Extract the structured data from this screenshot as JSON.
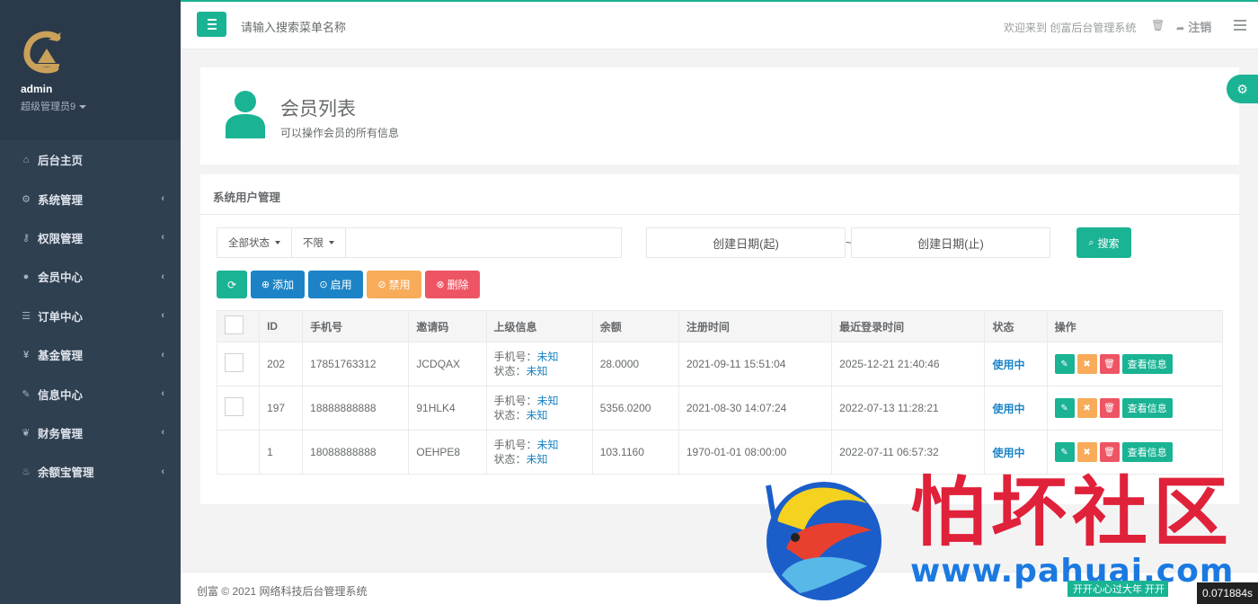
{
  "sidebar": {
    "user_name": "admin",
    "user_role": "超级管理员9",
    "items": [
      {
        "icon": "home-icon",
        "glyph": "⌂",
        "label": "后台主页",
        "has_arrow": false
      },
      {
        "icon": "cogs-icon",
        "glyph": "⚙",
        "label": "系统管理",
        "has_arrow": true
      },
      {
        "icon": "key-icon",
        "glyph": "⚷",
        "label": "权限管理",
        "has_arrow": true
      },
      {
        "icon": "user-icon",
        "glyph": "●",
        "label": "会员中心",
        "has_arrow": true
      },
      {
        "icon": "list-icon",
        "glyph": "☰",
        "label": "订单中心",
        "has_arrow": true
      },
      {
        "icon": "yen-icon",
        "glyph": "¥",
        "label": "基金管理",
        "has_arrow": true
      },
      {
        "icon": "wrench-icon",
        "glyph": "✎",
        "label": "信息中心",
        "has_arrow": true
      },
      {
        "icon": "leaf-icon",
        "glyph": "❦",
        "label": "财务管理",
        "has_arrow": true
      },
      {
        "icon": "fire-icon",
        "glyph": "♨",
        "label": "余额宝管理",
        "has_arrow": true
      }
    ]
  },
  "topbar": {
    "search_menu": "请输入搜索菜单名称",
    "welcome": "欢迎来到 创富后台管理系统",
    "logout": "注销"
  },
  "header": {
    "title": "会员列表",
    "subtitle": "可以操作会员的所有信息"
  },
  "panel": {
    "title": "系统用户管理",
    "filter_status": "全部状态",
    "filter_limit": "不限",
    "date_start": "创建日期(起)",
    "date_sep": "~",
    "date_end": "创建日期(止)",
    "search_label": "搜索"
  },
  "toolbar": {
    "add": "添加",
    "enable": "启用",
    "disable": "禁用",
    "delete": "删除"
  },
  "table": {
    "headers": [
      "",
      "ID",
      "手机号",
      "邀请码",
      "上级信息",
      "余额",
      "注册时间",
      "最近登录时间",
      "状态",
      "操作"
    ],
    "sup_phone_label": "手机号：",
    "sup_status_label": "状态：",
    "view_label": "查看信息",
    "rows": [
      {
        "checkbox": true,
        "id": "202",
        "phone": "17851763312",
        "invite": "JCDQAX",
        "sup_phone": "未知",
        "sup_status": "未知",
        "balance": "28.0000",
        "reg_time": "2021-09-11 15:51:04",
        "last_login": "2025-12-21 21:40:46",
        "status": "使用中"
      },
      {
        "checkbox": true,
        "id": "197",
        "phone": "18888888888",
        "invite": "91HLK4",
        "sup_phone": "未知",
        "sup_status": "未知",
        "balance": "5356.0200",
        "reg_time": "2021-08-30 14:07:24",
        "last_login": "2022-07-13 11:28:21",
        "status": "使用中"
      },
      {
        "checkbox": false,
        "id": "1",
        "phone": "18088888888",
        "invite": "OEHPE8",
        "sup_phone": "未知",
        "sup_status": "未知",
        "balance": "103.1160",
        "reg_time": "1970-01-01 08:00:00",
        "last_login": "2022-07-11 06:57:32",
        "status": "使用中"
      }
    ]
  },
  "footer": {
    "copyright": "创富 © 2021 网络科技后台管理系统"
  },
  "overlay": {
    "watermark_text": "怕坏社区",
    "watermark_url": "www.pahuai.com",
    "timer": "0.071884s",
    "green_tag": "开开心心过大年 开开"
  },
  "colors": {
    "accent": "#1ab394",
    "primary": "#1c84c6",
    "warning": "#f8ac59",
    "danger": "#ed5565",
    "sidebar": "#2f4050"
  }
}
